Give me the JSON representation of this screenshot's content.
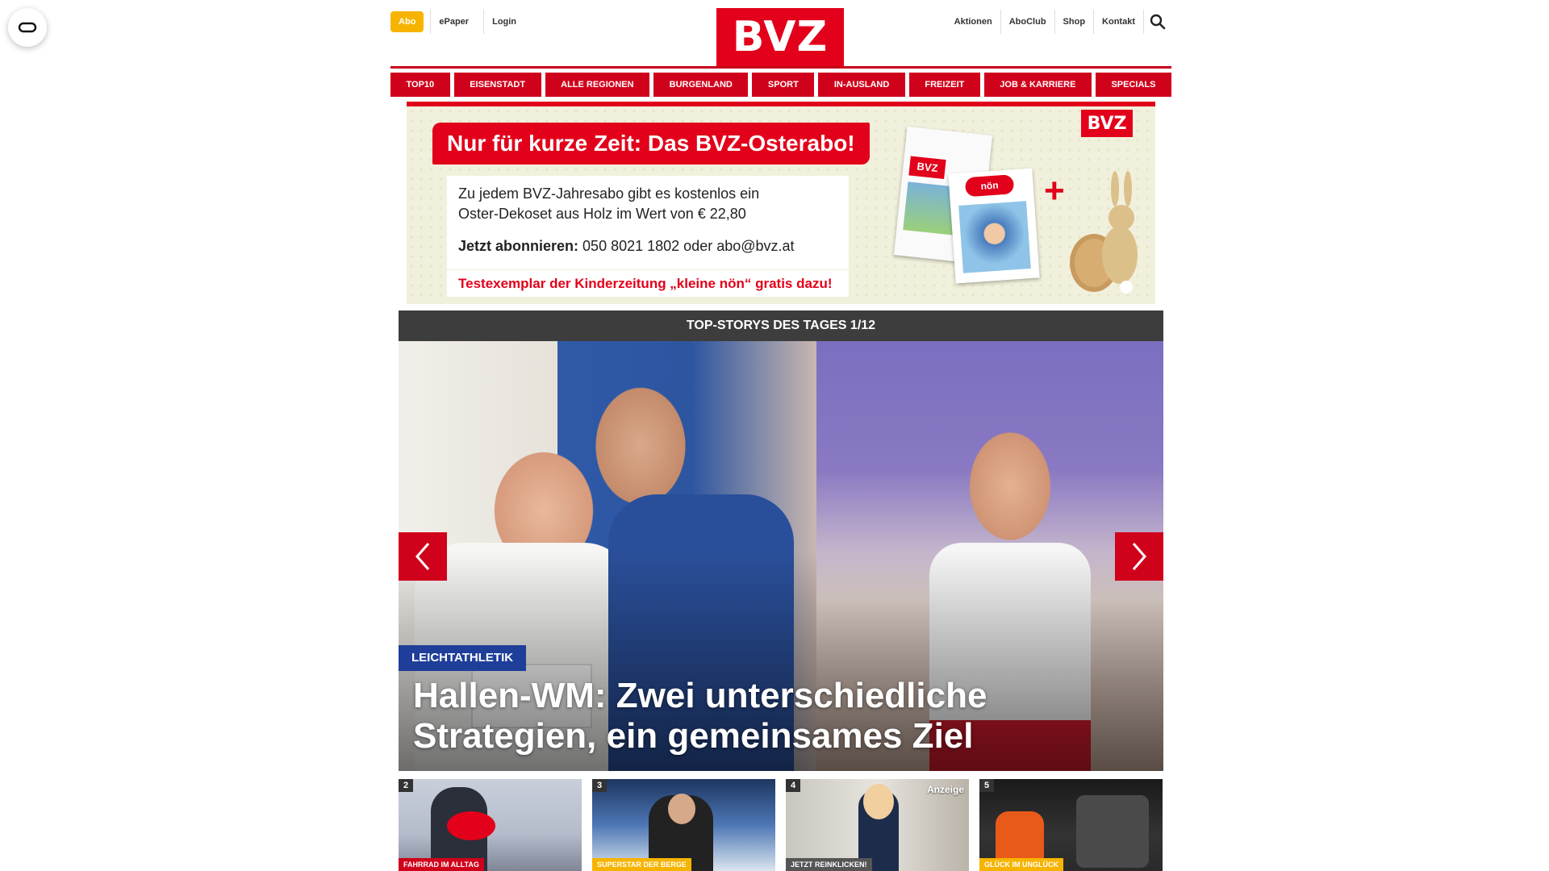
{
  "topbar": {
    "abo_label": "Abo",
    "left_links": [
      "ePaper",
      "Login"
    ],
    "logo": "BVZ",
    "right_links": [
      "Aktionen",
      "AboClub",
      "Shop",
      "Kontakt"
    ]
  },
  "nav": {
    "items": [
      "TOP10",
      "EISENSTADT",
      "ALLE REGIONEN",
      "BURGENLAND",
      "SPORT",
      "IN-AUSLAND",
      "FREIZEIT",
      "JOB & KARRIERE",
      "SPECIALS"
    ]
  },
  "ad": {
    "headline": "Nur für kurze Zeit: Das BVZ-Osterabo!",
    "body": "Zu jedem BVZ-Jahresabo gibt es kostenlos ein Oster-Dekoset aus Holz im Wert von € 22,80",
    "contact_label": "Jetzt abonnieren:",
    "contact_value": "050 8021 1802 oder abo@bvz.at",
    "free_offer": "Testexemplar der Kinderzeitung „kleine nön“ gratis dazu!",
    "logo": "BVZ",
    "paper1_logo": "BVZ",
    "paper2_logo": "nön"
  },
  "stories": {
    "header": "TOP-STORYS DES TAGES 1/12",
    "category": "LEICHTATHLETIK",
    "title": "Hallen-WM: Zwei unterschiedliche Strategien, ein gemeinsames Ziel"
  },
  "teasers": [
    {
      "num": "2",
      "tag": "FAHRRAD IM ALLTAG",
      "tag_color": "#d0021b",
      "ann": ""
    },
    {
      "num": "3",
      "tag": "SUPERSTAR DER BERGE",
      "tag_color": "#f6b400",
      "ann": ""
    },
    {
      "num": "4",
      "tag": "JETZT REINKLICKEN!",
      "tag_color": "#555555",
      "ann": "Anzeige"
    },
    {
      "num": "5",
      "tag": "GLÜCK IM UNGLÜCK",
      "tag_color": "#f6b400",
      "ann": ""
    }
  ],
  "colors": {
    "brand_red": "#e2001a",
    "nav_red": "#d0021b",
    "abo_yellow": "#f6b400",
    "category_blue": "#1f3e9a"
  },
  "icons": {
    "accessibility": "accessibility-icon",
    "search": "search-icon",
    "prev": "chevron-left-icon",
    "next": "chevron-right-icon"
  }
}
